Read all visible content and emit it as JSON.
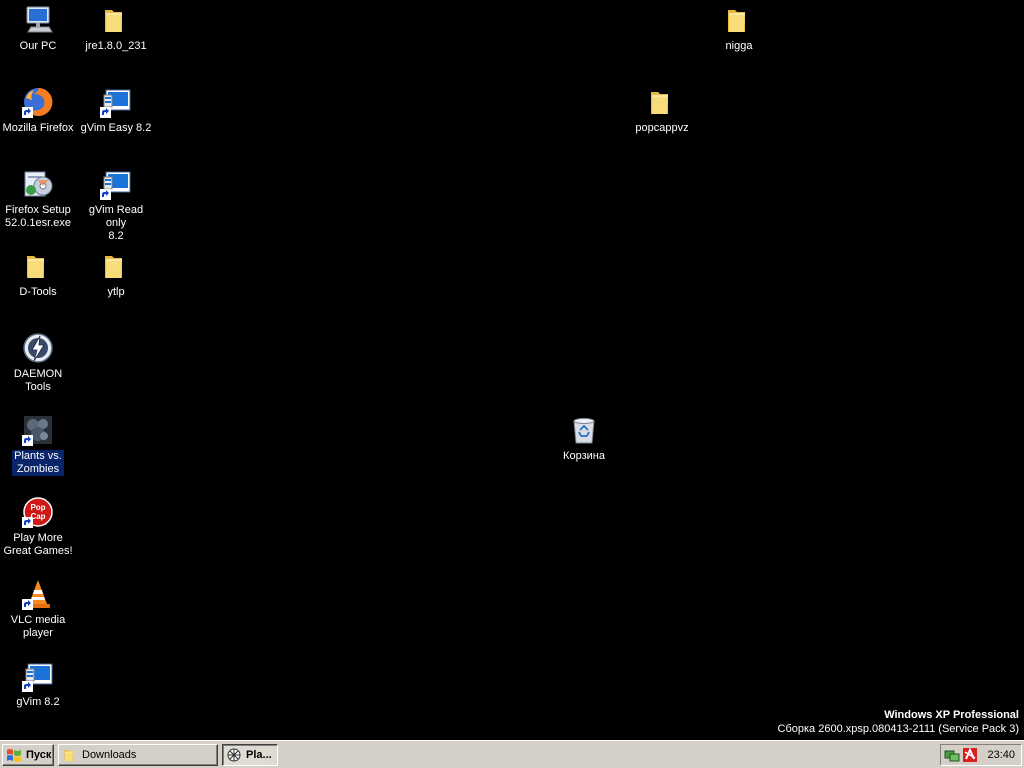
{
  "desktop": {
    "icons": {
      "our_pc": "Our PC",
      "jre": "jre1.8.0_231",
      "nigga": "nigga",
      "firefox": "Mozilla Firefox",
      "gvim_easy": "gVim Easy 8.2",
      "popcappvz": "popcappvz",
      "firefox_setup": "Firefox Setup\n52.0.1esr.exe",
      "gvim_readonly": "gVim Read only\n8.2",
      "dtools": "D-Tools",
      "ytlp": "ytlp",
      "daemon": "DAEMON Tools",
      "pvz": "Plants vs.\nZombies",
      "recycle": "Корзина",
      "popcap": "Play More\nGreat Games!",
      "vlc": "VLC media\nplayer",
      "gvim": "gVim 8.2"
    },
    "selected_icon": "pvz"
  },
  "watermark": {
    "edition": "Windows XP Professional",
    "build": "Сборка 2600.xpsp.080413-2111 (Service Pack 3)"
  },
  "taskbar": {
    "start_label": "Пуск",
    "tasks": [
      {
        "label": "Downloads",
        "icon": "folder-icon",
        "active": false
      },
      {
        "label": "Pla...",
        "icon": "pvz-app-icon",
        "active": true
      }
    ],
    "tray": {
      "icons": [
        "network-icon",
        "security-alert-icon"
      ],
      "clock": "23:40"
    }
  },
  "colors": {
    "desktop_bg": "#000000",
    "taskbar_bg": "#d4d0c8",
    "selection": "#0a246a",
    "folder_yellow": "#f5d46c"
  }
}
